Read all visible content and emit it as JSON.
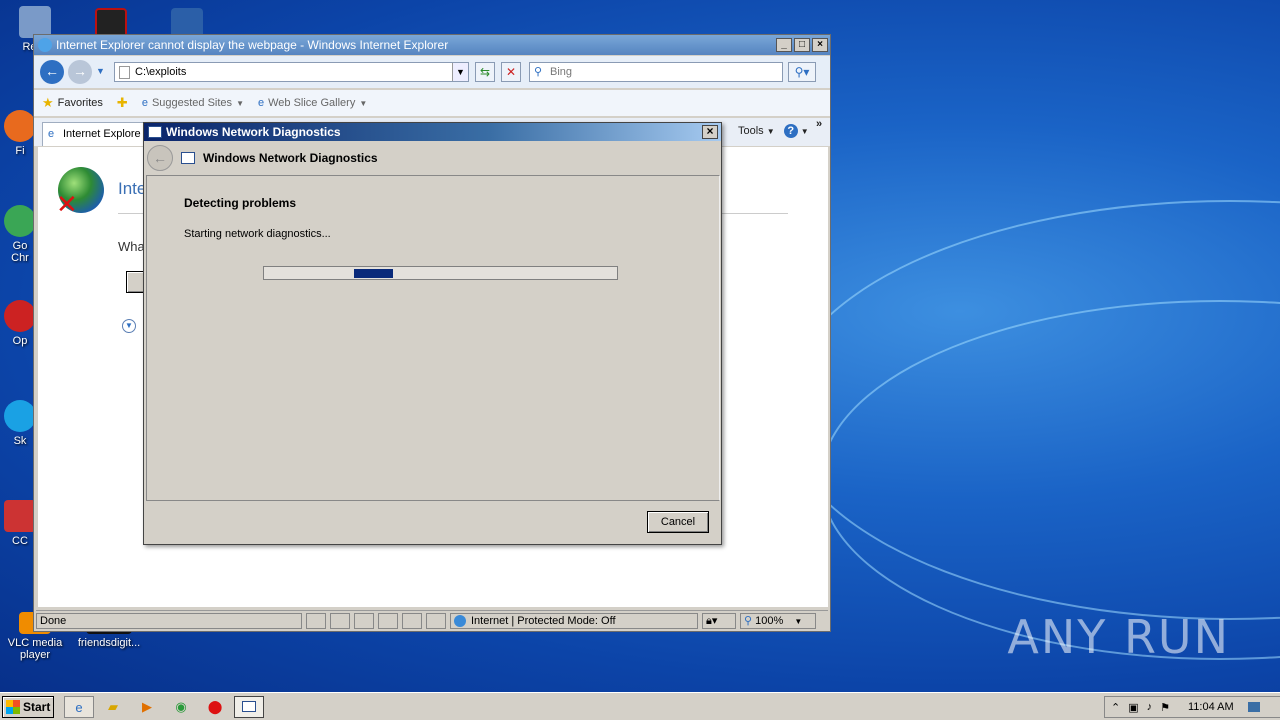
{
  "desktop": {
    "icons": [
      {
        "label": "Recy",
        "color": "#7a9ac8"
      },
      {
        "label": "",
        "color": "#222222"
      },
      {
        "label": "",
        "color": "#2b5fa8"
      },
      {
        "label": "Fi",
        "color": "#e86a1e"
      },
      {
        "label": "Go\nChr",
        "color": "#3aa655"
      },
      {
        "label": "Op",
        "color": "#cc2222"
      },
      {
        "label": "Sk",
        "color": "#1aa1e4"
      },
      {
        "label": "CC",
        "color": "#cc3333"
      },
      {
        "label": "VLC media\nplayer",
        "color": "#f08c00"
      },
      {
        "label": "friendsdigit...",
        "color": "#111111"
      }
    ],
    "watermark": "ANY RUN"
  },
  "ie": {
    "title": "Internet Explorer cannot display the webpage - Windows Internet Explorer",
    "address": "C:\\exploits",
    "search_placeholder": "Bing",
    "favorites": {
      "favorites_label": "Favorites",
      "suggested_sites": "Suggested Sites",
      "web_slice_gallery": "Web Slice Gallery"
    },
    "tab_label": "Internet Explore",
    "tools_label": "Tools",
    "content": {
      "heading": "Inte",
      "what": "Wha"
    },
    "status": {
      "text": "Done",
      "zone": "Internet | Protected Mode: Off",
      "zoom": "100%"
    }
  },
  "dialog": {
    "title": "Windows Network Diagnostics",
    "header": "Windows Network Diagnostics",
    "detecting": "Detecting problems",
    "starting": "Starting network diagnostics...",
    "progress": {
      "chunk_start": 0.255,
      "chunk_width": 0.11
    },
    "cancel_label": "Cancel"
  },
  "taskbar": {
    "start_label": "Start",
    "clock": "11:04 AM"
  }
}
